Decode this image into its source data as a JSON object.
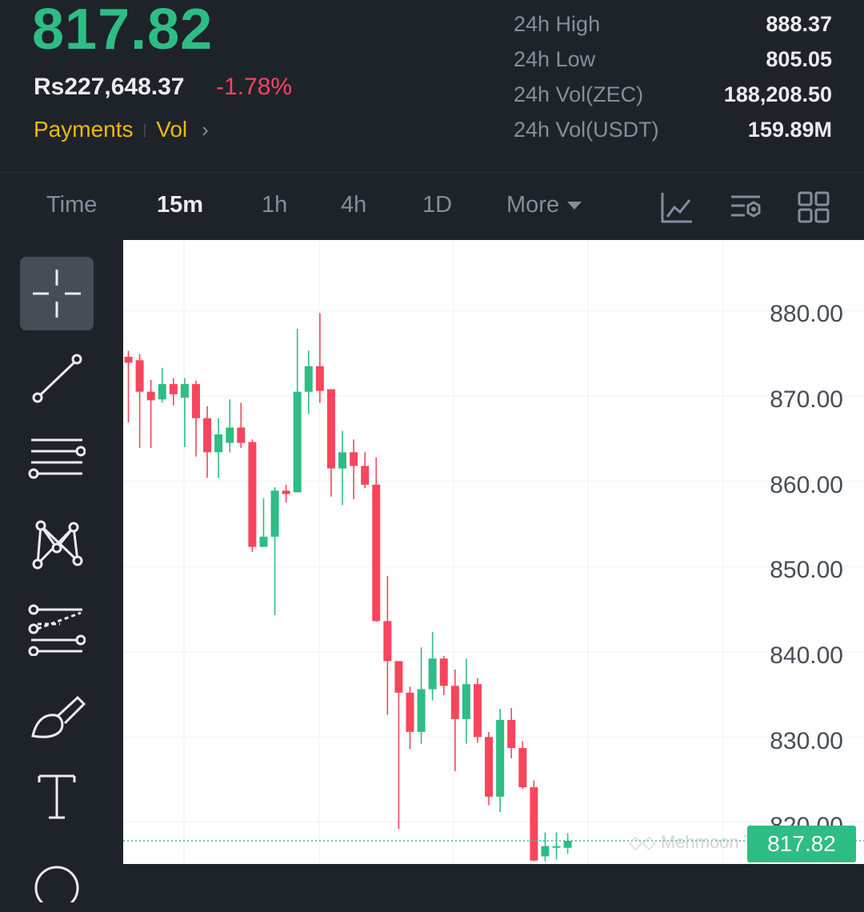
{
  "header": {
    "last_price": "817.82",
    "fiat_price": "Rs227,648.37",
    "change_pct": "-1.78%",
    "tag_payments": "Payments",
    "tag_vol": "Vol",
    "stats": [
      {
        "label": "24h High",
        "value": "888.37"
      },
      {
        "label": "24h Low",
        "value": "805.05"
      },
      {
        "label": "24h Vol(ZEC)",
        "value": "188,208.50"
      },
      {
        "label": "24h Vol(USDT)",
        "value": "159.89M"
      }
    ]
  },
  "tabs": {
    "time": "Time",
    "m15": "15m",
    "h1": "1h",
    "h4": "4h",
    "d1": "1D",
    "more": "More",
    "active": "15m"
  },
  "toolbar": {
    "icons": [
      "crosshair-icon",
      "trend-line-icon",
      "horizontal-lines-icon",
      "pattern-icon",
      "fibonacci-icon",
      "brush-icon",
      "text-icon",
      "circle-icon"
    ],
    "selected": "crosshair-icon"
  },
  "colors": {
    "up": "#2ebd85",
    "down": "#f6465d",
    "accent": "#f0b90b"
  },
  "chart_data": {
    "type": "candlestick",
    "y_labels": [
      "880.00",
      "870.00",
      "860.00",
      "850.00",
      "840.00",
      "830.00",
      "820.00"
    ],
    "ylim": [
      815.1,
      888.3
    ],
    "current_price_label": "817.82",
    "watermark": "◇◇ Mehmoon Trader",
    "candles": [
      {
        "o": 874.6,
        "h": 875.3,
        "l": 866.9,
        "c": 873.9
      },
      {
        "o": 874.2,
        "h": 874.9,
        "l": 863.9,
        "c": 870.5
      },
      {
        "o": 870.5,
        "h": 871.9,
        "l": 863.9,
        "c": 869.5
      },
      {
        "o": 869.6,
        "h": 873.3,
        "l": 869.2,
        "c": 871.4
      },
      {
        "o": 871.4,
        "h": 872.1,
        "l": 868.9,
        "c": 870.2
      },
      {
        "o": 869.8,
        "h": 872.1,
        "l": 864.0,
        "c": 871.4
      },
      {
        "o": 871.4,
        "h": 871.8,
        "l": 862.9,
        "c": 867.4
      },
      {
        "o": 867.4,
        "h": 868.8,
        "l": 860.4,
        "c": 863.4
      },
      {
        "o": 863.4,
        "h": 867.4,
        "l": 860.4,
        "c": 865.5
      },
      {
        "o": 864.5,
        "h": 869.6,
        "l": 863.4,
        "c": 866.3
      },
      {
        "o": 866.3,
        "h": 869.2,
        "l": 863.9,
        "c": 864.5
      },
      {
        "o": 864.6,
        "h": 864.9,
        "l": 851.7,
        "c": 852.3
      },
      {
        "o": 852.3,
        "h": 858.0,
        "l": 852.3,
        "c": 853.5
      },
      {
        "o": 853.5,
        "h": 859.3,
        "l": 844.3,
        "c": 858.9
      },
      {
        "o": 858.9,
        "h": 859.6,
        "l": 857.5,
        "c": 858.5
      },
      {
        "o": 858.7,
        "h": 877.9,
        "l": 858.7,
        "c": 870.5
      },
      {
        "o": 870.5,
        "h": 875.3,
        "l": 867.9,
        "c": 873.5
      },
      {
        "o": 873.5,
        "h": 879.7,
        "l": 869.2,
        "c": 870.6
      },
      {
        "o": 870.8,
        "h": 870.8,
        "l": 858.2,
        "c": 861.5
      },
      {
        "o": 861.5,
        "h": 865.9,
        "l": 857.2,
        "c": 863.4
      },
      {
        "o": 863.4,
        "h": 864.9,
        "l": 857.9,
        "c": 861.8
      },
      {
        "o": 861.8,
        "h": 863.4,
        "l": 859.2,
        "c": 859.6
      },
      {
        "o": 859.6,
        "h": 862.8,
        "l": 843.5,
        "c": 843.6
      },
      {
        "o": 843.6,
        "h": 848.9,
        "l": 832.6,
        "c": 838.9
      },
      {
        "o": 838.9,
        "h": 838.9,
        "l": 819.2,
        "c": 835.2
      },
      {
        "o": 835.2,
        "h": 835.9,
        "l": 828.6,
        "c": 830.6
      },
      {
        "o": 830.6,
        "h": 840.5,
        "l": 829.2,
        "c": 835.6
      },
      {
        "o": 835.6,
        "h": 842.3,
        "l": 834.3,
        "c": 839.2
      },
      {
        "o": 839.2,
        "h": 839.5,
        "l": 834.9,
        "c": 836.0
      },
      {
        "o": 836.0,
        "h": 837.9,
        "l": 826.0,
        "c": 832.1
      },
      {
        "o": 832.1,
        "h": 839.2,
        "l": 829.2,
        "c": 836.2
      },
      {
        "o": 836.2,
        "h": 836.9,
        "l": 829.3,
        "c": 830.0
      },
      {
        "o": 830.0,
        "h": 830.6,
        "l": 822.0,
        "c": 823.0
      },
      {
        "o": 823.0,
        "h": 833.3,
        "l": 821.2,
        "c": 832.0
      },
      {
        "o": 832.0,
        "h": 833.4,
        "l": 827.5,
        "c": 828.7
      },
      {
        "o": 828.7,
        "h": 829.5,
        "l": 823.9,
        "c": 824.1
      },
      {
        "o": 824.1,
        "h": 824.9,
        "l": 815.4,
        "c": 815.5
      },
      {
        "o": 816.0,
        "h": 818.8,
        "l": 815.4,
        "c": 817.2
      },
      {
        "o": 817.0,
        "h": 818.8,
        "l": 815.6,
        "c": 817.2
      },
      {
        "o": 817.0,
        "h": 818.7,
        "l": 816.3,
        "c": 817.82
      }
    ]
  }
}
